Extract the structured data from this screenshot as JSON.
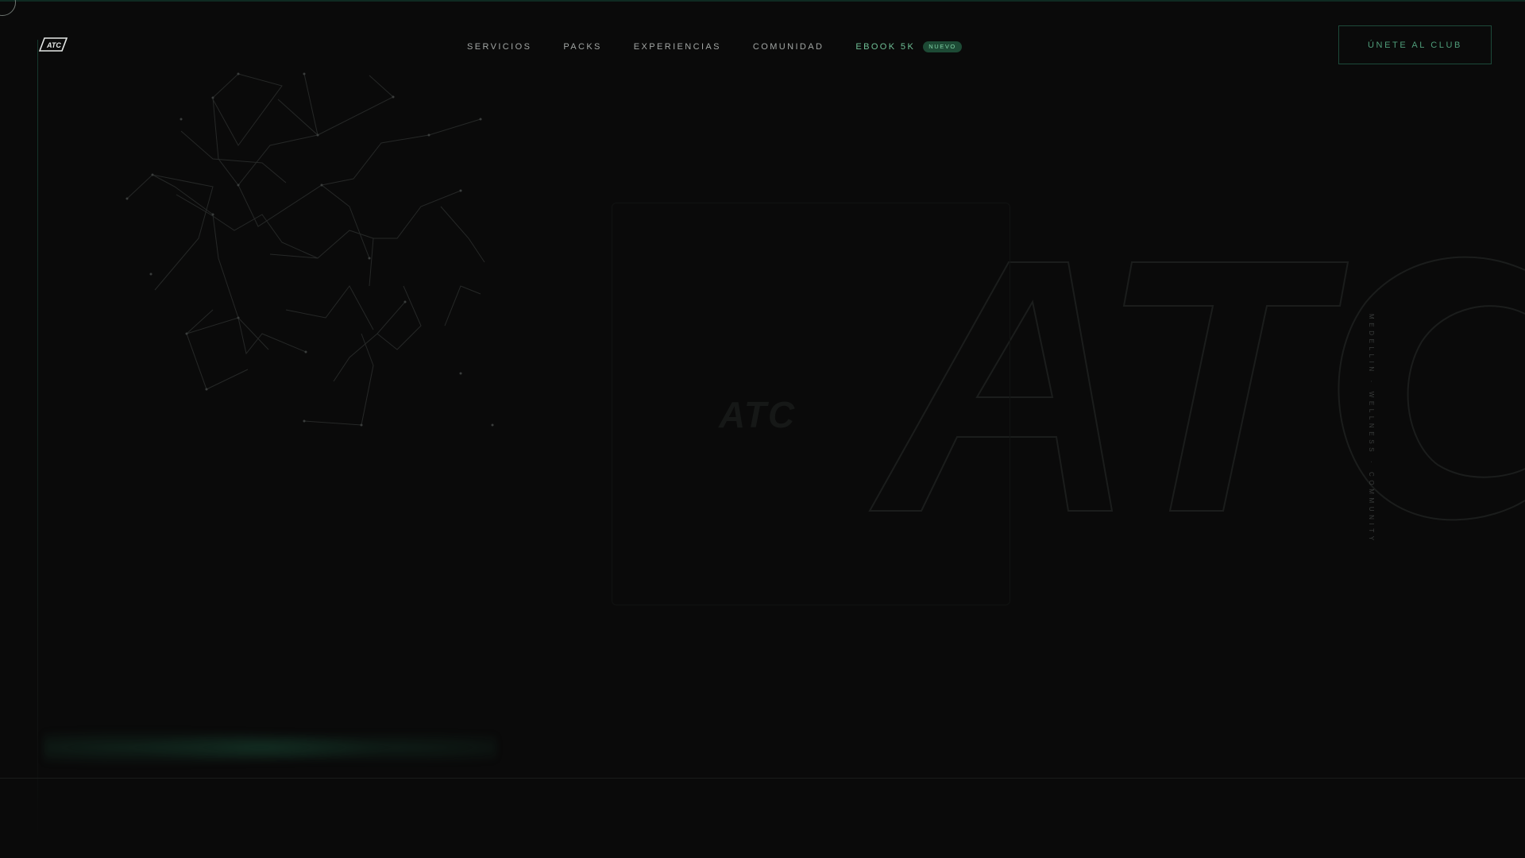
{
  "nav": {
    "items": [
      {
        "label": "SERVICIOS"
      },
      {
        "label": "PACKS"
      },
      {
        "label": "EXPERIENCIAS"
      },
      {
        "label": "COMUNIDAD"
      },
      {
        "label": "EBOOK 5K",
        "badge": "NUEVO"
      }
    ]
  },
  "cta": {
    "label": "ÚNETE AL CLUB"
  },
  "brand": {
    "logo_text": "ATC",
    "hero_word": "ATC",
    "small_mark": "ATC"
  },
  "side_text": "MEDELLIN · WELLNESS · COMMUNITY",
  "colors": {
    "background": "#0a0a0a",
    "accent": "#6fbf95",
    "badge_bg": "#1d4a35",
    "cta_border": "#1d4a3a"
  },
  "icons": {
    "logo": "atc-logo-icon",
    "cursor": "cursor-ring-icon"
  }
}
